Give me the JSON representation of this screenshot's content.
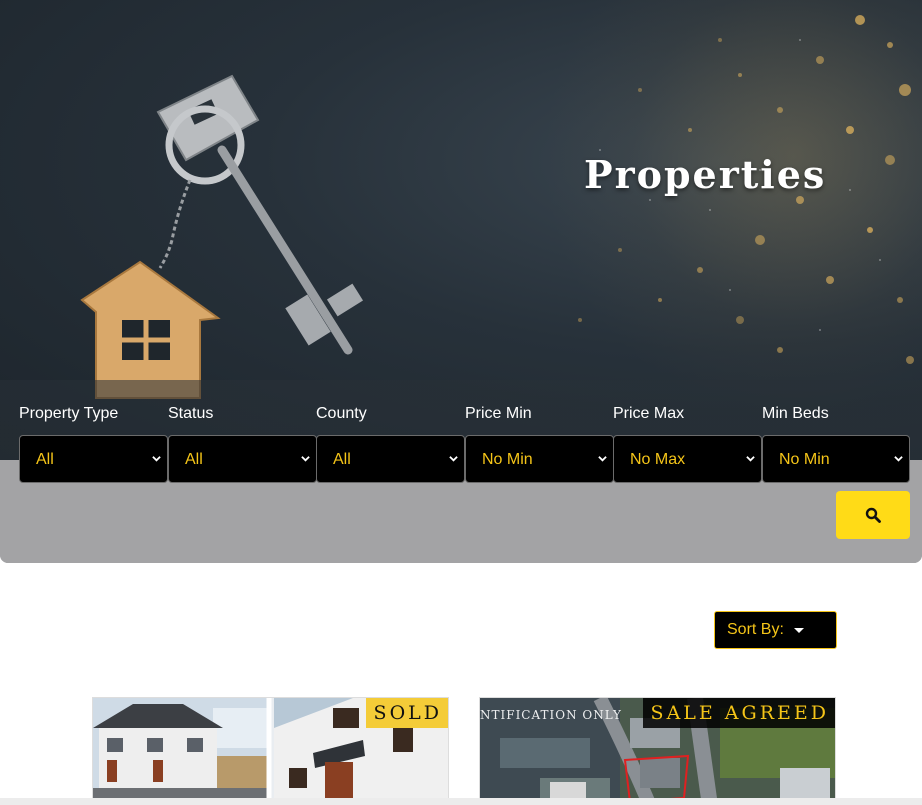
{
  "hero": {
    "title": "Properties"
  },
  "filters": [
    {
      "label": "Property Type",
      "value": "All"
    },
    {
      "label": "Status",
      "value": "All"
    },
    {
      "label": "County",
      "value": "All"
    },
    {
      "label": "Price Min",
      "value": "No Min"
    },
    {
      "label": "Price Max",
      "value": "No Max"
    },
    {
      "label": "Min Beds",
      "value": "No Min"
    }
  ],
  "search": {
    "icon": "search-icon"
  },
  "sort": {
    "label": "Sort By:"
  },
  "listings": [
    {
      "badge": "SOLD"
    },
    {
      "badge": "SALE AGREED",
      "overlay_text": "NTIFICATION ONLY"
    }
  ],
  "colors": {
    "accent": "#f5c518",
    "button": "#ffdb17",
    "panel": "#a3a3a5",
    "hero_bg": "#27313a"
  }
}
